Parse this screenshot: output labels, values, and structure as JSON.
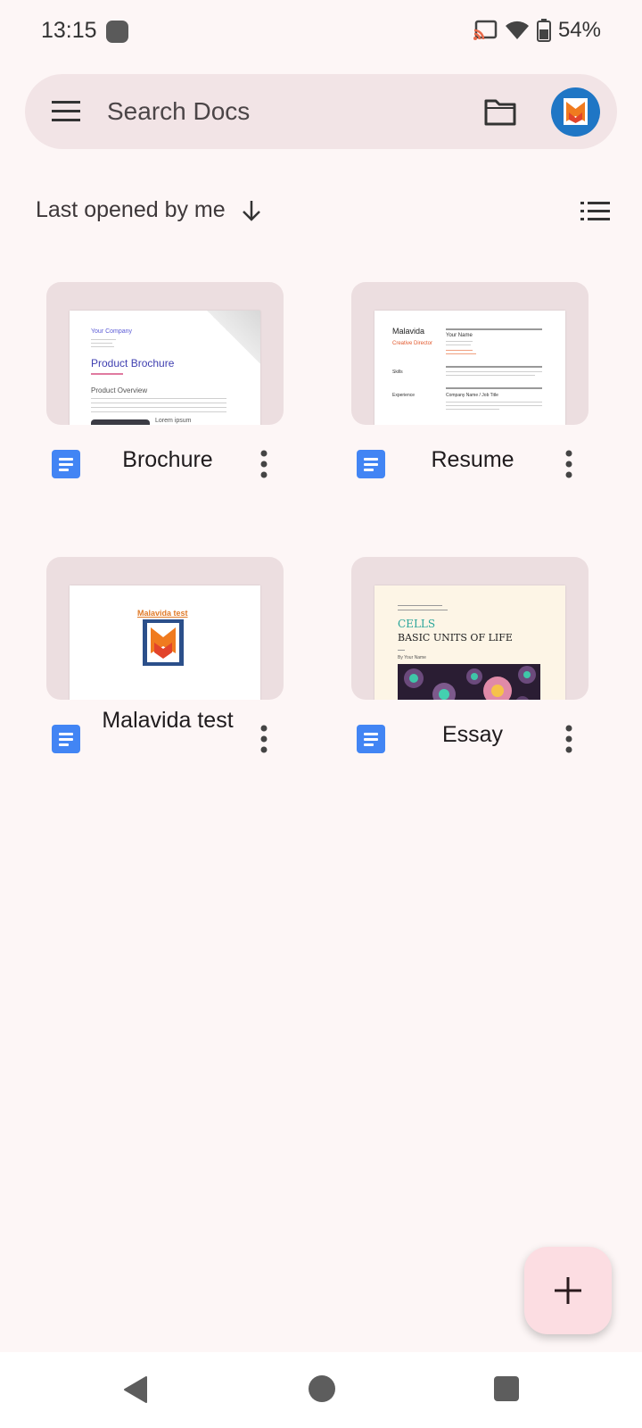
{
  "status_bar": {
    "time": "13:15",
    "battery": "54%",
    "icons": [
      "cast-icon",
      "wifi-icon",
      "battery-icon"
    ]
  },
  "search": {
    "placeholder": "Search Docs"
  },
  "sort": {
    "label": "Last opened by me"
  },
  "documents": [
    {
      "title": "Brochure",
      "thumbnail": {
        "company": "Your Company",
        "heading": "Product Brochure",
        "section": "Product Overview",
        "caption": "Lorem ipsum"
      }
    },
    {
      "title": "Resume",
      "thumbnail": {
        "name": "Malavida",
        "role": "Creative Director",
        "your_name": "Your Name",
        "skills": "Skills",
        "experience": "Experience",
        "company_line": "Company Name / Job Title"
      }
    },
    {
      "title": "Malavida test",
      "thumbnail": {
        "heading": "Malavida test"
      }
    },
    {
      "title": "Essay",
      "thumbnail": {
        "heading1": "CELLS",
        "heading2": "BASIC UNITS OF LIFE",
        "byline": "By Your Name"
      }
    }
  ],
  "colors": {
    "background": "#fdf6f6",
    "search_bar": "#f2e4e6",
    "thumb_bg": "#ecdee0",
    "doc_icon": "#4285f4",
    "fab": "#fcdde2"
  }
}
